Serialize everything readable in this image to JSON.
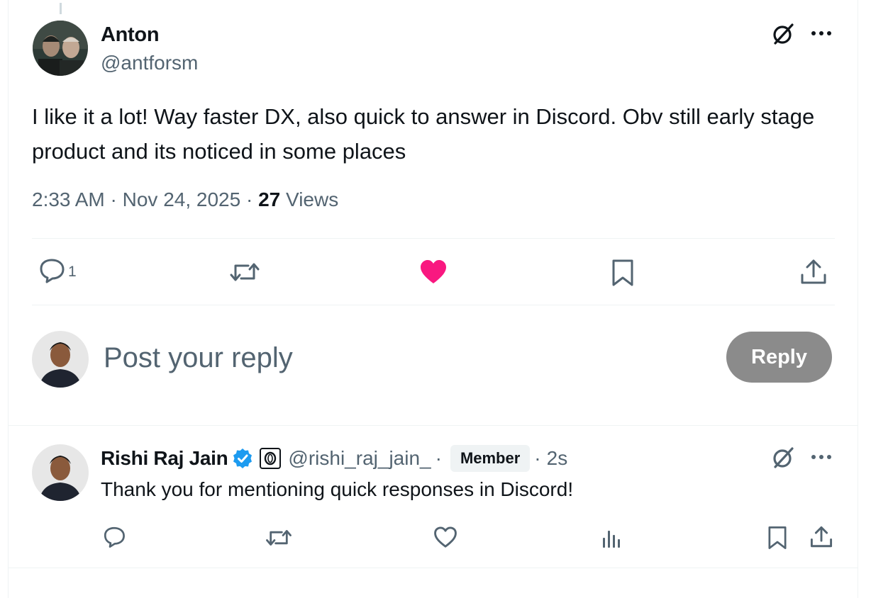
{
  "tweet": {
    "author_name": "Anton",
    "author_handle": "@antforsm",
    "text": "I like it a lot! Way faster DX, also quick to answer in Discord. Obv still early stage product and its noticed in some places",
    "time": "2:33 AM",
    "date": "Nov 24, 2025",
    "separator": "·",
    "views_count": "27",
    "views_label": "Views",
    "reply_count": "1",
    "liked": true
  },
  "composer": {
    "placeholder": "Post your reply",
    "button_label": "Reply"
  },
  "reply": {
    "author_name": "Rishi Raj Jain",
    "author_handle": "@rishi_raj_jain_",
    "separator": "·",
    "badge": "Member",
    "time": "2s",
    "text": "Thank you for mentioning quick responses in Discord!"
  },
  "icons": {
    "grok": "grok-icon",
    "more": "more-icon",
    "reply": "reply-icon",
    "retweet": "retweet-icon",
    "like": "heart-icon",
    "bookmark": "bookmark-icon",
    "share": "share-icon",
    "views": "analytics-icon",
    "verified": "verified-badge-icon"
  },
  "colors": {
    "text": "#0f1419",
    "secondary": "#536471",
    "like": "#f91880",
    "verified": "#1d9bf0",
    "reply_button": "#8b8b8b",
    "divider": "#eff3f4"
  }
}
